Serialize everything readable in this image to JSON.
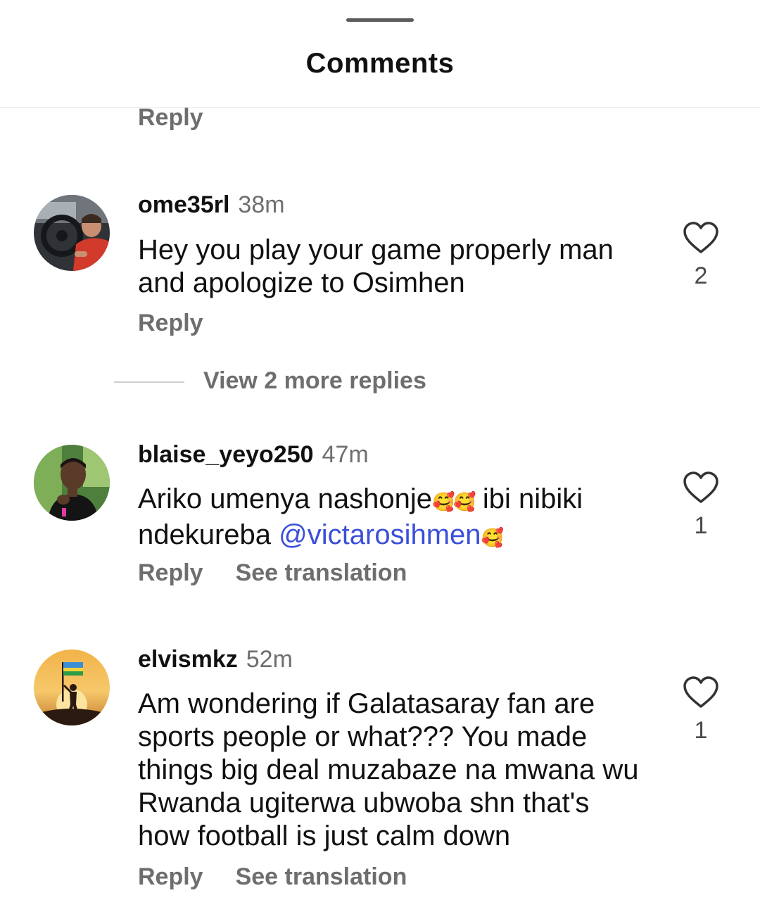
{
  "header": {
    "title": "Comments"
  },
  "top_reply_label": "Reply",
  "comments": [
    {
      "username": "ome35rl",
      "time": "38m",
      "text": "Hey you play your game properly man and apologize to Osimhen",
      "reply_label": "Reply",
      "likes": "2",
      "avatar": "car-interior-avatar"
    },
    {
      "username": "blaise_yeyo250",
      "time": "47m",
      "text_part1": "Ariko umenya nashonje",
      "emoji1": "🥰🥰",
      "text_part2": " ibi nibiki ndekureba ",
      "mention": "@victarosihmen",
      "emoji2": "🥰",
      "reply_label": "Reply",
      "translate_label": "See translation",
      "likes": "1",
      "avatar": "portrait-avatar"
    },
    {
      "username": "elvismkz",
      "time": "52m",
      "text": "Am wondering if Galatasaray fan are sports people or what??? You made things big deal muzabaze na mwana wu Rwanda ugiterwa ubwoba shn that's how football is just calm down",
      "reply_label": "Reply",
      "translate_label": "See translation",
      "likes": "1",
      "avatar": "sunset-flag-avatar"
    }
  ],
  "more_replies": {
    "label": "View 2 more replies"
  },
  "colors": {
    "text": "#111111",
    "muted": "#6e6e6e",
    "mention": "#3b4fd8",
    "divider": "#ececec"
  }
}
